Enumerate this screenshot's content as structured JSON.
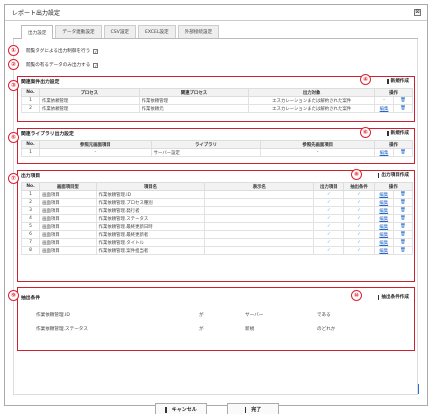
{
  "dialog": {
    "title": "レポート出力設定",
    "close_label": "⊠"
  },
  "tabs": [
    {
      "label": "出力設定",
      "active": true
    },
    {
      "label": "データ連動設定",
      "active": false
    },
    {
      "label": "CSV設定",
      "active": false
    },
    {
      "label": "EXCEL設定",
      "active": false
    },
    {
      "label": "外部接続設定",
      "active": false
    }
  ],
  "markers": [
    "①",
    "②",
    "③",
    "④",
    "⑤",
    "⑥",
    "⑦",
    "⑧",
    "⑨",
    "⑩"
  ],
  "options": {
    "opt1": "閲覧タグによる出力制御を行う",
    "opt2": "閲覧の有るデータのみ出力する"
  },
  "related": {
    "title": "関連案件出力設定",
    "action": "新規作成",
    "headers": [
      "No.",
      "プロセス",
      "関連プロセス",
      "出力対象",
      "操作"
    ],
    "rows": [
      {
        "no": "1",
        "process": "作業依頼管理",
        "related": "作業依頼管理",
        "target": "エスカレーションまたは解約された案件",
        "op1": "-",
        "op2": "🗑"
      },
      {
        "no": "2",
        "process": "作業依頼管理",
        "related": "作業依頼元",
        "target": "エスカレーションまたは解約された案件",
        "op1": "編集",
        "op2": "🗑"
      }
    ]
  },
  "library": {
    "title": "関連ライブラリ出力設定",
    "action": "新規作成",
    "headers": [
      "No.",
      "参照元画面項目",
      "ライブラリ",
      "参照先画面項目",
      "操作"
    ],
    "rows": [
      {
        "no": "1",
        "src": "-",
        "lib": "サーバー設定",
        "dst": "-",
        "op1": "編集",
        "op2": "🗑"
      }
    ]
  },
  "output": {
    "title": "出力項目",
    "action": "出力項目作成",
    "headers": [
      "No.",
      "画面項目型",
      "項目名",
      "表示名",
      "出力項目",
      "抽出条件",
      "操作"
    ],
    "rows": [
      {
        "no": "1",
        "type": "画面項目",
        "name": "作業依頼管理.ID",
        "display": "",
        "out": "✓",
        "cond": "✓",
        "op1": "編集",
        "op2": "🗑"
      },
      {
        "no": "2",
        "type": "画面項目",
        "name": "作業依頼管理.プロセス種別",
        "display": "",
        "out": "✓",
        "cond": "✓",
        "op1": "編集",
        "op2": "🗑"
      },
      {
        "no": "3",
        "type": "画面項目",
        "name": "作業依頼管理.発行者",
        "display": "",
        "out": "✓",
        "cond": "✓",
        "op1": "編集",
        "op2": "🗑"
      },
      {
        "no": "4",
        "type": "画面項目",
        "name": "作業依頼管理.ステータス",
        "display": "",
        "out": "✓",
        "cond": "✓",
        "op1": "編集",
        "op2": "🗑"
      },
      {
        "no": "5",
        "type": "画面項目",
        "name": "作業依頼管理.最終更新日時",
        "display": "",
        "out": "✓",
        "cond": "✓",
        "op1": "編集",
        "op2": "🗑"
      },
      {
        "no": "6",
        "type": "画面項目",
        "name": "作業依頼管理.最終更新者",
        "display": "",
        "out": "✓",
        "cond": "✓",
        "op1": "編集",
        "op2": "🗑"
      },
      {
        "no": "7",
        "type": "画面項目",
        "name": "作業依頼管理.タイトル",
        "display": "",
        "out": "✓",
        "cond": "✓",
        "op1": "編集",
        "op2": "🗑"
      },
      {
        "no": "8",
        "type": "画面項目",
        "name": "作業依頼管理.案件担当者",
        "display": "",
        "out": "✓",
        "cond": "✓",
        "op1": "編集",
        "op2": "🗑"
      }
    ]
  },
  "extract": {
    "title": "抽出条件",
    "action": "抽出条件作成",
    "rows": [
      {
        "field": "作業依頼管理.ID",
        "particle": "が",
        "value": "サーバー",
        "op": "である"
      },
      {
        "field": "作業依頼管理.ステータス",
        "particle": "が",
        "value": "新規",
        "op": "のどれか"
      }
    ]
  },
  "buttons": {
    "cancel": "キャンセル",
    "done": "完了"
  },
  "colors": {
    "marker": "#dd2233",
    "link": "#2366c8",
    "check": "#5d9bd8"
  }
}
